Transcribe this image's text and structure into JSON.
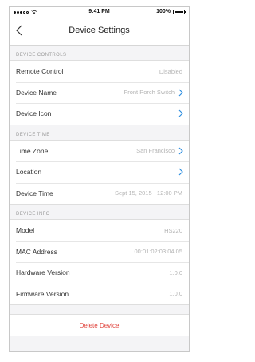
{
  "status_bar": {
    "time": "9:41 PM",
    "battery": "100%"
  },
  "nav": {
    "title": "Device Settings",
    "back_icon": "chevron-left-icon"
  },
  "sections": {
    "controls": {
      "header": "DEVICE CONTROLS",
      "remote_control": {
        "label": "Remote Control",
        "value": "Disabled"
      },
      "device_name": {
        "label": "Device Name",
        "value": "Front Porch Switch"
      },
      "device_icon": {
        "label": "Device Icon",
        "value": ""
      }
    },
    "time": {
      "header": "DEVICE TIME",
      "time_zone": {
        "label": "Time Zone",
        "value": "San Francisco"
      },
      "location": {
        "label": "Location",
        "value": ""
      },
      "device_time": {
        "label": "Device Time",
        "value": "Sept 15, 2015   12:00 PM"
      }
    },
    "info": {
      "header": "DEVICE INFO",
      "model": {
        "label": "Model",
        "value": "HS220"
      },
      "mac_address": {
        "label": "MAC Address",
        "value": "00:01:02:03:04:05"
      },
      "hardware_version": {
        "label": "Hardware Version",
        "value": "1.0.0"
      },
      "firmware_version": {
        "label": "Firmware Version",
        "value": "1.0.0"
      }
    }
  },
  "actions": {
    "delete_label": "Delete Device"
  },
  "colors": {
    "accent": "#2f8ee0",
    "danger": "#e0413a",
    "muted": "#b4b4b4",
    "background": "#f4f4f6"
  }
}
